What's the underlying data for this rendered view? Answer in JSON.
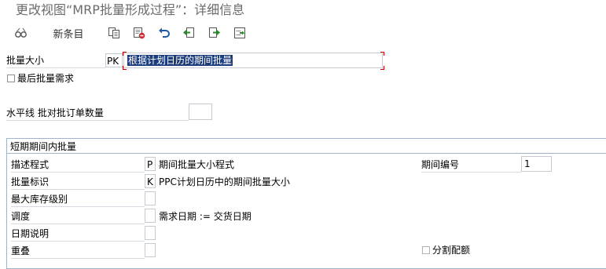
{
  "window": {
    "title": "更改视图“MRP批量形成过程”：详细信息"
  },
  "toolbar": {
    "new_entries": "新条目",
    "icons": [
      "glasses-icon",
      "copy-icon",
      "delete-icon",
      "undo-icon",
      "previous-entry-icon",
      "next-entry-icon",
      "other-entry-icon"
    ]
  },
  "lot_size": {
    "label": "批量大小",
    "code": "PK",
    "description": "根据计划日历的期间批量"
  },
  "last_lot_requirement": {
    "label": "最后批量需求",
    "checked": false
  },
  "horizon": {
    "label": "水平线 批对批订单数量",
    "value": ""
  },
  "short_term": {
    "title": "短期期间内批量",
    "rows": [
      {
        "label": "描述程式",
        "value": "P",
        "text": "期间批量大小程式"
      },
      {
        "label": "批量标识",
        "value": "K",
        "text": "PPC计划日历中的期间批量大小"
      },
      {
        "label": "最大库存级别",
        "value": "",
        "text": ""
      },
      {
        "label": "调度",
        "value": "",
        "text": "需求日期 := 交货日期"
      },
      {
        "label": "日期说明",
        "value": "",
        "text": ""
      },
      {
        "label": "重叠",
        "value": "",
        "text": ""
      }
    ],
    "period_number": {
      "label": "期间编号",
      "value": "1"
    },
    "split_quota": {
      "label": "分割配额",
      "checked": false
    }
  }
}
